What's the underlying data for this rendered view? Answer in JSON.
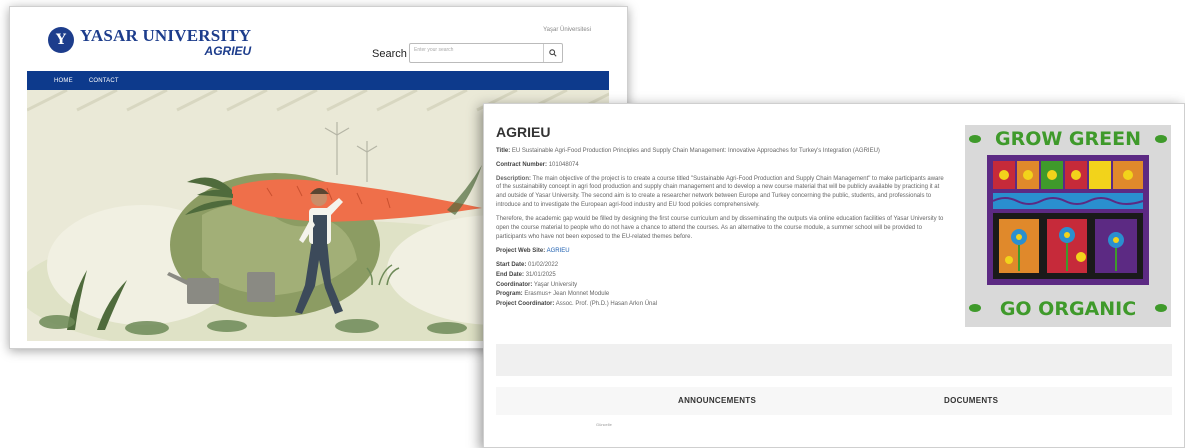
{
  "site": {
    "logo_letter": "Y",
    "logo_title": "YASAR UNIVERSITY",
    "logo_subtitle": "AGRIEU",
    "top_link": "Yaşar Üniversitesi",
    "search_label": "Search",
    "search_placeholder": "Enter your search",
    "search_icon": "search-icon",
    "nav": [
      {
        "label": "HOME"
      },
      {
        "label": "CONTACT"
      }
    ],
    "hero_image": "illustration of farmer carrying giant carrot with watering cans and plants"
  },
  "project": {
    "title": "AGRIEU",
    "fields": {
      "title_label": "Title:",
      "title_value": "EU Sustainable Agri-Food Production Principles and Supply Chain Management: Innovative Approaches for Turkey's Integration (AGRIEU)",
      "contract_label": "Contract Number:",
      "contract_value": "101048074",
      "description_label": "Description:",
      "description_value": "The main objective of the project is to create a course titled \"Sustainable Agri-Food Production and Supply Chain Management\" to make participants aware of the sustainability concept in agri food production and supply chain management and to develop a new course material that will be publicly available by practicing it at and outside of Yasar University. The second aim is to create a researcher network between Europe and Turkey concerning the public, students, and professionals to introduce and to investigate the European agri-food industry and EU food policies comprehensively.",
      "paragraph2": "Therefore, the academic gap would be filled by designing the first course curriculum and by disseminating the outputs via online education facilities of Yasar University to open the course material to people who do not have a chance to attend the courses. As an alternative to the course module, a summer school will be provided to participants who have not been exposed to the EU-related themes before.",
      "website_label": "Project Web Site:",
      "website_value": "AGRIEU",
      "start_label": "Start Date:",
      "start_value": "01/02/2022",
      "end_label": "End Date:",
      "end_value": "31/01/2025",
      "coordinator_label": "Coordinator:",
      "coordinator_value": "Yaşar University",
      "program_label": "Program:",
      "program_value": "Erasmus+ Jean Monnet Module",
      "pc_label": "Project Coordinator:",
      "pc_value": "Assoc. Prof. (Ph.D.) Hasan Arkın Ünal"
    },
    "poster": {
      "top_text": "GROW GREEN",
      "bottom_text": "GO ORGANIC",
      "colors": {
        "green": "#3f9a2b",
        "purple": "#5c2a83",
        "red": "#c62a3a",
        "orange": "#e0892b",
        "yellow": "#f2d31b",
        "blue": "#2a8fcf"
      }
    },
    "sections": {
      "announcements": "ANNOUNCEMENTS",
      "documents": "DOCUMENTS",
      "small_text": "Güncelle"
    }
  },
  "colors": {
    "brand_blue": "#1d3d8c",
    "nav_blue": "#0d3a8c",
    "link_blue": "#1d5fb0"
  }
}
